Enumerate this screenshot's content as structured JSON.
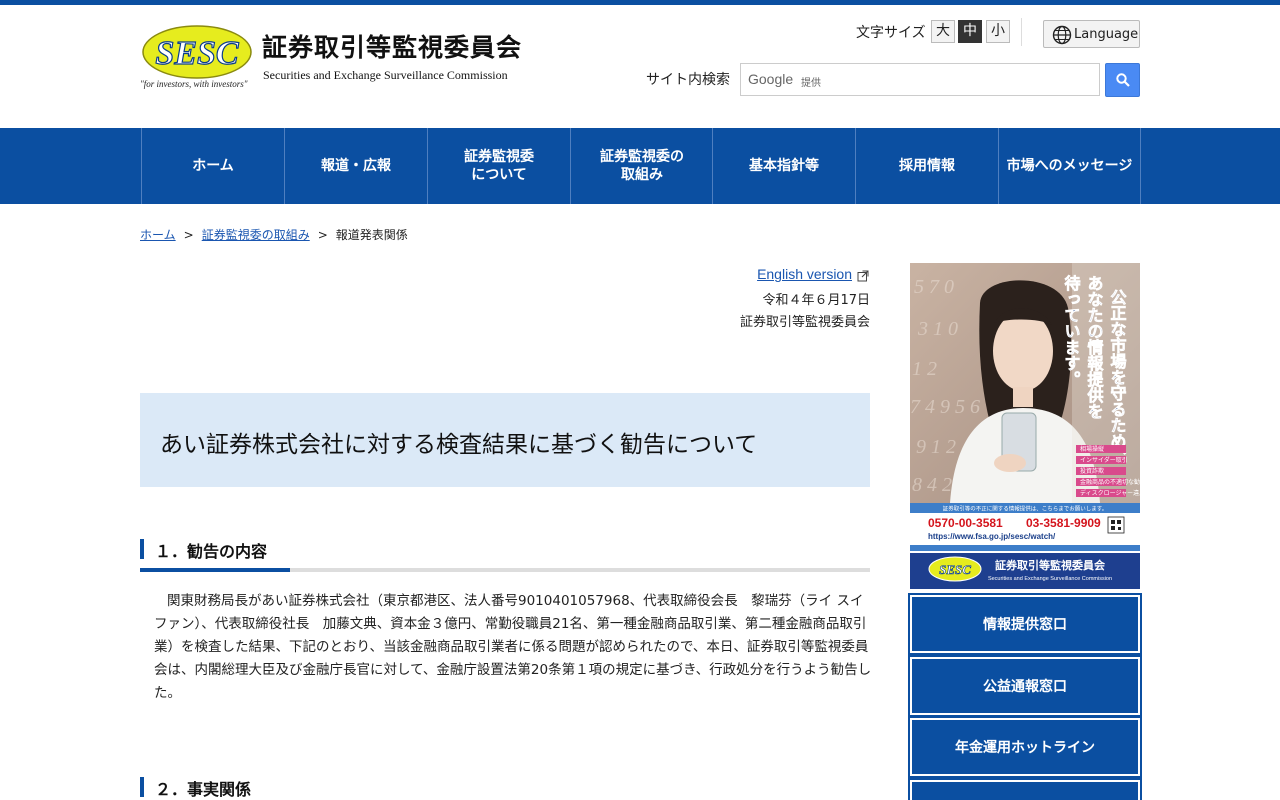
{
  "header": {
    "logo_text": "SESC",
    "logo_tagline": "\"for investors, with investors\"",
    "title_jp": "証券取引等監視委員会",
    "title_en": "Securities and Exchange Surveillance Commission",
    "font_size_label": "文字サイズ",
    "font_sizes": [
      "大",
      "中",
      "小"
    ],
    "font_size_selected": "中",
    "language_label": "Language",
    "search_label": "サイト内検索",
    "search_google": "Google",
    "search_provided": "提供",
    "search_placeholder": ""
  },
  "nav": {
    "items": [
      {
        "label": "ホーム"
      },
      {
        "label": "報道・広報"
      },
      {
        "label": "証券監視委\nについて"
      },
      {
        "label": "証券監視委の\n取組み"
      },
      {
        "label": "基本指針等"
      },
      {
        "label": "採用情報"
      },
      {
        "label": "市場へのメッセージ"
      }
    ]
  },
  "breadcrumb": {
    "items": [
      "ホーム",
      "証券監視委の取組み",
      "報道発表関係"
    ],
    "separator": ">"
  },
  "article": {
    "english_link": "English version",
    "date": "令和４年６月17日",
    "issuer": "証券取引等監視委員会",
    "title": "あい証券株式会社に対する検査結果に基づく勧告について",
    "section1_heading": "１．勧告の内容",
    "section1_body": "関東財務局長があい証券株式会社（東京都港区、法人番号9010401057968、代表取締役会長　黎瑞芬（ライ スイファン）、代表取締役社長　加藤文典、資本金３億円、常勤役職員21名、第一種金融商品取引業、第二種金融商品取引業）を検査した結果、下記のとおり、当該金融商品取引業者に係る問題が認められたので、本日、証券取引等監視委員会は、内閣総理大臣及び金融庁長官に対して、金融庁設置法第20条第１項の規定に基づき、行政処分を行うよう勧告した。",
    "section2_heading": "２．事実関係"
  },
  "sidebar": {
    "banner": {
      "headline": "公正な市場を守るため、あなたの情報提供を待っています。",
      "tags": [
        "相場操縦",
        "インサイダー取引",
        "投資詐欺",
        "金融商品の不適切な勧誘",
        "ディスクロージャー違反"
      ],
      "notice": "証券取引等の不正に関する情報提供は、こちらまでお願いします。",
      "phone_free": "0570-00-3581",
      "phone": "03-3581-9909",
      "url": "https://www.fsa.go.jp/sesc/watch/",
      "footer_logo": "SESC",
      "footer_jp": "証券取引等監視委員会",
      "footer_en": "Securities and Exchange Surveillance Commission"
    },
    "buttons": [
      {
        "label": "情報提供窓口"
      },
      {
        "label": "公益通報窓口"
      },
      {
        "label": "年金運用ホットライン"
      },
      {
        "label": ""
      }
    ]
  },
  "colors": {
    "brand_blue": "#0b4fa1",
    "title_bg": "#dbe9f7",
    "link": "#1a56b0",
    "logo_yellow": "#e6ec1e"
  }
}
